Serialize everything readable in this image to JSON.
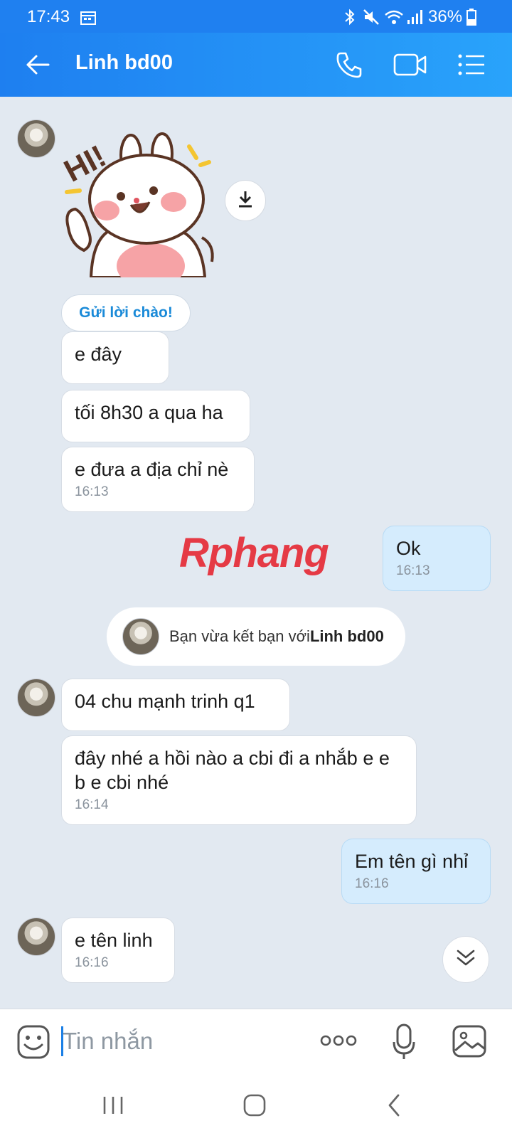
{
  "status_bar": {
    "time": "17:43",
    "battery": "36%"
  },
  "header": {
    "contact_name": "Linh bd00"
  },
  "chat": {
    "greet_button": "Gửi lời chào!",
    "messages_1": [
      {
        "text": "e đây"
      },
      {
        "text": "tối 8h30 a qua ha"
      },
      {
        "text": "e đưa a địa chỉ nè",
        "time": "16:13"
      }
    ],
    "my_msg_1": {
      "text": "Ok",
      "time": "16:13"
    },
    "watermark": "Rphang",
    "friend_notice": {
      "prefix": "Bạn vừa kết bạn với ",
      "name": "Linh bd00"
    },
    "messages_2": [
      {
        "text": "04 chu mạnh trinh q1"
      },
      {
        "text": "đây nhé a hồi nào a cbi đi a nhắb e e b e cbi nhé",
        "time": "16:14"
      }
    ],
    "my_msg_2": {
      "text": "Em tên gì nhỉ",
      "time": "16:16"
    },
    "messages_3": [
      {
        "text": "e tên linh",
        "time": "16:16"
      }
    ]
  },
  "input": {
    "placeholder": "Tin nhắn"
  },
  "colors": {
    "header_start": "#1e7ff0",
    "header_end": "#29a3fb",
    "chat_bg": "#e2e9f1",
    "my_bubble": "#d5ecfd",
    "link_blue": "#1a8ad8"
  },
  "icons": [
    "back-arrow-icon",
    "phone-icon",
    "video-call-icon",
    "menu-list-icon",
    "download-icon",
    "double-chevron-down-icon",
    "emoji-icon",
    "more-dots-icon",
    "microphone-icon",
    "image-icon",
    "recents-nav-icon",
    "home-nav-icon",
    "back-nav-icon"
  ]
}
